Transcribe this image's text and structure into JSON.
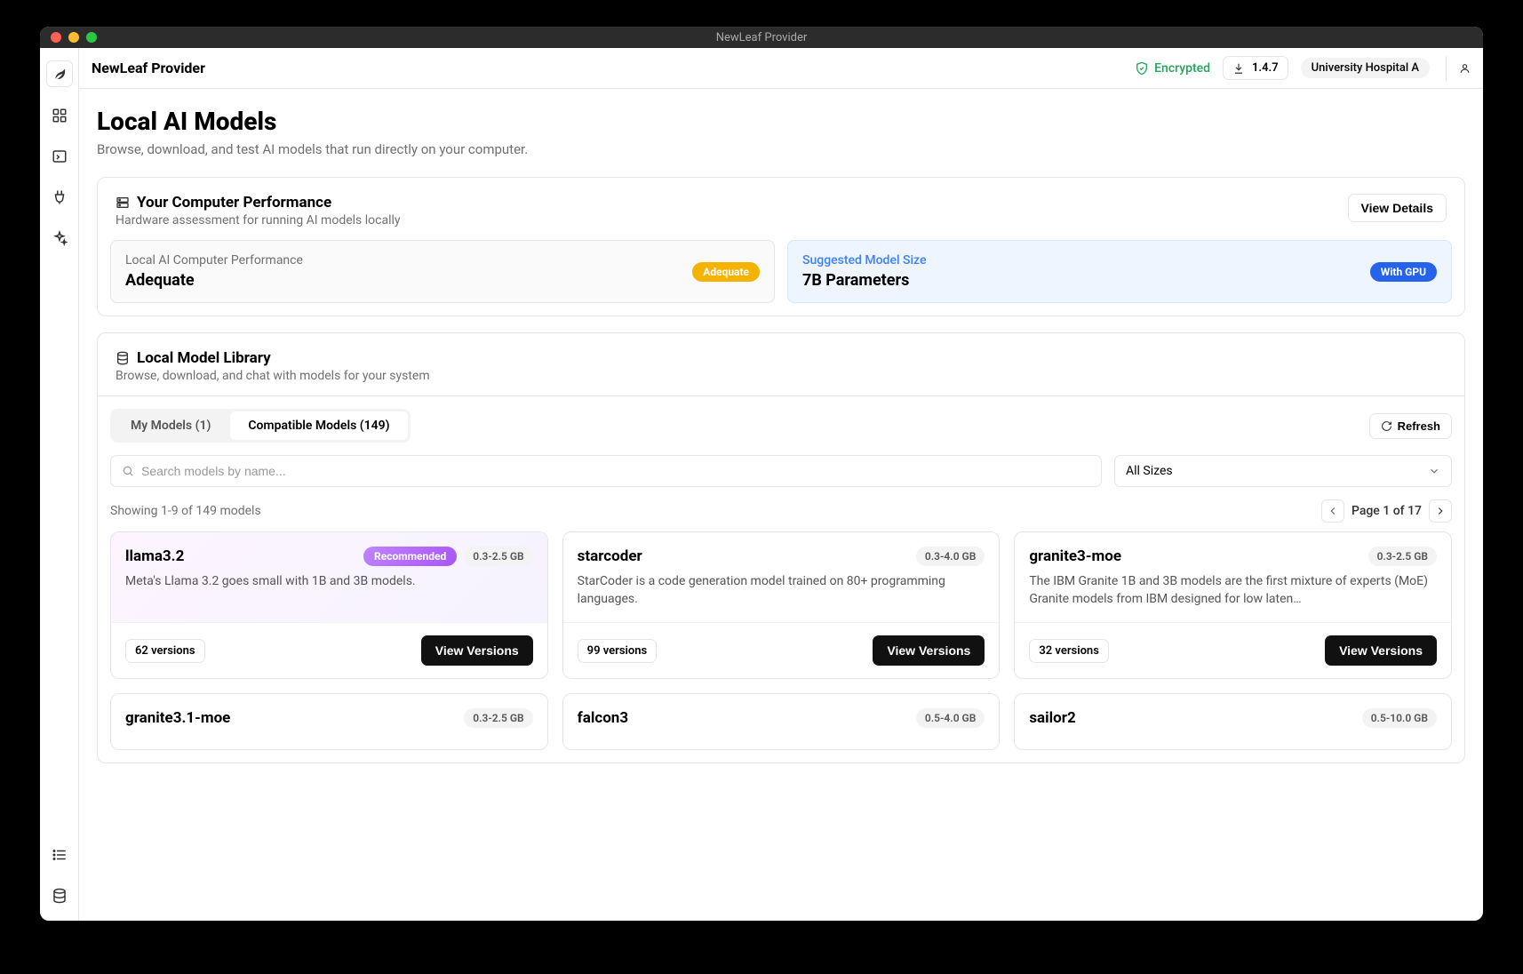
{
  "window": {
    "title": "NewLeaf Provider"
  },
  "topbar": {
    "app_title": "NewLeaf Provider",
    "encrypted_label": "Encrypted",
    "version": "1.4.7",
    "hospital": "University Hospital A"
  },
  "page": {
    "title": "Local AI Models",
    "subtitle": "Browse, download, and test AI models that run directly on your computer."
  },
  "performance": {
    "section_title": "Your Computer Performance",
    "section_subtitle": "Hardware assessment for running AI models locally",
    "view_details": "View Details",
    "perf_label": "Local AI Computer Performance",
    "perf_value": "Adequate",
    "perf_badge": "Adequate",
    "suggested_label": "Suggested Model Size",
    "suggested_value": "7B Parameters",
    "gpu_badge": "With GPU"
  },
  "library": {
    "section_title": "Local Model Library",
    "section_subtitle": "Browse, download, and chat with models for your system",
    "tabs": {
      "my_models": "My Models (1)",
      "compatible": "Compatible Models (149)"
    },
    "refresh": "Refresh",
    "search_placeholder": "Search models by name...",
    "size_filter": "All Sizes",
    "showing": "Showing 1-9 of 149 models",
    "page_info": "Page 1 of 17"
  },
  "models": [
    {
      "name": "llama3.2",
      "recommended": true,
      "size": "0.3-2.5 GB",
      "desc": "Meta's Llama 3.2 goes small with 1B and 3B models.",
      "versions": "62 versions",
      "view": "View Versions"
    },
    {
      "name": "starcoder",
      "recommended": false,
      "size": "0.3-4.0 GB",
      "desc": "StarCoder is a code generation model trained on 80+ programming languages.",
      "versions": "99 versions",
      "view": "View Versions"
    },
    {
      "name": "granite3-moe",
      "recommended": false,
      "size": "0.3-2.5 GB",
      "desc": "The IBM Granite 1B and 3B models are the first mixture of experts (MoE) Granite models from IBM designed for low laten…",
      "versions": "32 versions",
      "view": "View Versions"
    },
    {
      "name": "granite3.1-moe",
      "recommended": false,
      "size": "0.3-2.5 GB",
      "desc": "",
      "versions": "",
      "view": ""
    },
    {
      "name": "falcon3",
      "recommended": false,
      "size": "0.5-4.0 GB",
      "desc": "",
      "versions": "",
      "view": ""
    },
    {
      "name": "sailor2",
      "recommended": false,
      "size": "0.5-10.0 GB",
      "desc": "",
      "versions": "",
      "view": ""
    }
  ],
  "labels": {
    "recommended": "Recommended"
  }
}
